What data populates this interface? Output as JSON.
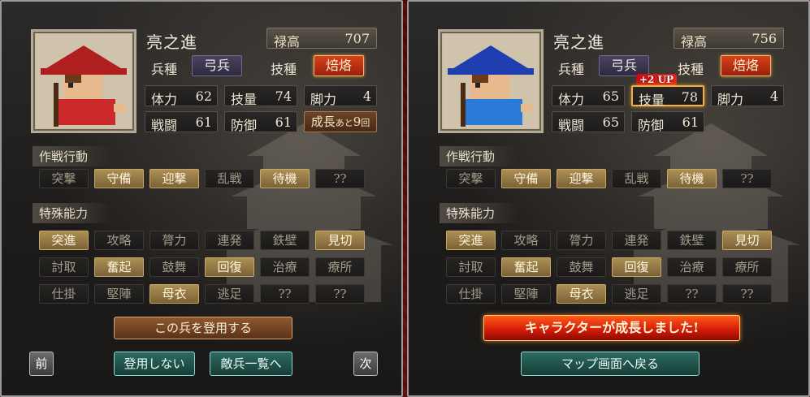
{
  "colors": {
    "frame_red": "#4a0707",
    "active_gold": "#ad8f55",
    "teal_button": "#2d6a60",
    "tech_red": "#d8421a",
    "banner_red": "#d11a08"
  },
  "panels": [
    {
      "portrait": {
        "helmet_color": "#b01f1f",
        "shirt_color": "#cc2a2a"
      },
      "name": "亮之進",
      "salary_label": "禄高",
      "salary_value": "707",
      "unit_label": "兵種",
      "unit_value": "弓兵",
      "tech_label": "技種",
      "tech_value": "焙烙",
      "stats": [
        {
          "label": "体力",
          "value": "62"
        },
        {
          "label": "技量",
          "value": "74"
        },
        {
          "label": "脚力",
          "value": "4"
        },
        {
          "label": "戦闘",
          "value": "61"
        },
        {
          "label": "防御",
          "value": "61"
        }
      ],
      "growth": {
        "label": "成長",
        "small": "あと",
        "value": "9",
        "unit": "回"
      },
      "tactics_title": "作戦行動",
      "tactics": [
        {
          "label": "突撃",
          "active": false
        },
        {
          "label": "守備",
          "active": true
        },
        {
          "label": "迎撃",
          "active": true
        },
        {
          "label": "乱戦",
          "active": false
        },
        {
          "label": "待機",
          "active": true
        },
        {
          "label": "??",
          "active": false
        }
      ],
      "abilities_title": "特殊能力",
      "abilities": [
        {
          "label": "突進",
          "active": true
        },
        {
          "label": "攻略",
          "active": false
        },
        {
          "label": "膂力",
          "active": false
        },
        {
          "label": "連発",
          "active": false
        },
        {
          "label": "鉄壁",
          "active": false
        },
        {
          "label": "見切",
          "active": true
        },
        {
          "label": "討取",
          "active": false
        },
        {
          "label": "奮起",
          "active": true
        },
        {
          "label": "鼓舞",
          "active": false
        },
        {
          "label": "回復",
          "active": true
        },
        {
          "label": "治療",
          "active": false
        },
        {
          "label": "療所",
          "active": false
        },
        {
          "label": "仕掛",
          "active": false
        },
        {
          "label": "堅陣",
          "active": false
        },
        {
          "label": "母衣",
          "active": true
        },
        {
          "label": "逃足",
          "active": false
        },
        {
          "label": "??",
          "active": false
        },
        {
          "label": "??",
          "active": false
        }
      ],
      "recruit_button": "この兵を登用する",
      "prev_button": "前",
      "decline_button": "登用しない",
      "enemy_list_button": "敵兵一覧へ",
      "next_button": "次"
    },
    {
      "portrait": {
        "helmet_color": "#1f3fb0",
        "shirt_color": "#2a7ad8"
      },
      "name": "亮之進",
      "salary_label": "禄高",
      "salary_value": "756",
      "unit_label": "兵種",
      "unit_value": "弓兵",
      "tech_label": "技種",
      "tech_value": "焙烙",
      "up_badge": "+2 UP",
      "stats": [
        {
          "label": "体力",
          "value": "65"
        },
        {
          "label": "技量",
          "value": "78"
        },
        {
          "label": "脚力",
          "value": "4"
        },
        {
          "label": "戦闘",
          "value": "65"
        },
        {
          "label": "防御",
          "value": "61"
        }
      ],
      "tactics_title": "作戦行動",
      "tactics": [
        {
          "label": "突撃",
          "active": false
        },
        {
          "label": "守備",
          "active": true
        },
        {
          "label": "迎撃",
          "active": true
        },
        {
          "label": "乱戦",
          "active": false
        },
        {
          "label": "待機",
          "active": true
        },
        {
          "label": "??",
          "active": false
        }
      ],
      "abilities_title": "特殊能力",
      "abilities": [
        {
          "label": "突進",
          "active": true
        },
        {
          "label": "攻略",
          "active": false
        },
        {
          "label": "膂力",
          "active": false
        },
        {
          "label": "連発",
          "active": false
        },
        {
          "label": "鉄壁",
          "active": false
        },
        {
          "label": "見切",
          "active": true
        },
        {
          "label": "討取",
          "active": false
        },
        {
          "label": "奮起",
          "active": true
        },
        {
          "label": "鼓舞",
          "active": false
        },
        {
          "label": "回復",
          "active": true
        },
        {
          "label": "治療",
          "active": false
        },
        {
          "label": "療所",
          "active": false
        },
        {
          "label": "仕掛",
          "active": false
        },
        {
          "label": "堅陣",
          "active": false
        },
        {
          "label": "母衣",
          "active": true
        },
        {
          "label": "逃足",
          "active": false
        },
        {
          "label": "??",
          "active": false
        },
        {
          "label": "??",
          "active": false
        }
      ],
      "growth_banner": "キャラクターが成長しました!",
      "back_button": "マップ画面へ戻る"
    }
  ]
}
